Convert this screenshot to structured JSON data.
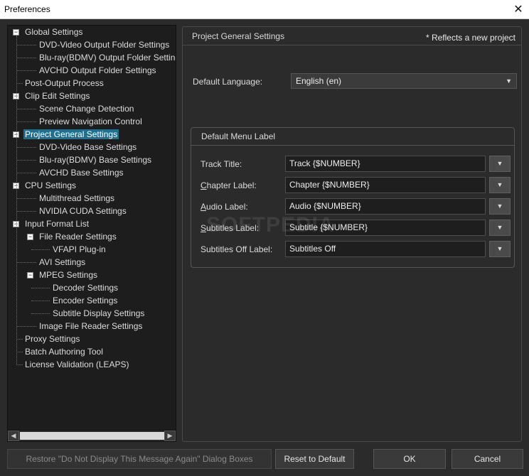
{
  "window": {
    "title": "Preferences"
  },
  "tree": [
    {
      "label": "Global Settings",
      "level": 0,
      "expander": "minus"
    },
    {
      "label": "DVD-Video Output Folder Settings",
      "level": 1
    },
    {
      "label": "Blu-ray(BDMV) Output Folder Settings",
      "level": 1
    },
    {
      "label": "AVCHD Output Folder Settings",
      "level": 1
    },
    {
      "label": "Post-Output Process",
      "level": 0
    },
    {
      "label": "Clip Edit Settings",
      "level": 0,
      "expander": "minus"
    },
    {
      "label": "Scene Change Detection",
      "level": 1
    },
    {
      "label": "Preview Navigation Control",
      "level": 1
    },
    {
      "label": "Project General Settings",
      "level": 0,
      "expander": "minus",
      "selected": true
    },
    {
      "label": "DVD-Video Base Settings",
      "level": 1
    },
    {
      "label": "Blu-ray(BDMV) Base Settings",
      "level": 1
    },
    {
      "label": "AVCHD Base Settings",
      "level": 1
    },
    {
      "label": "CPU Settings",
      "level": 0,
      "expander": "minus"
    },
    {
      "label": "Multithread Settings",
      "level": 1
    },
    {
      "label": "NVIDIA CUDA Settings",
      "level": 1
    },
    {
      "label": "Input Format List",
      "level": 0,
      "expander": "minus"
    },
    {
      "label": "File Reader Settings",
      "level": 1,
      "expander": "minus"
    },
    {
      "label": "VFAPI Plug-in",
      "level": 2
    },
    {
      "label": "AVI Settings",
      "level": 1
    },
    {
      "label": "MPEG Settings",
      "level": 1,
      "expander": "minus"
    },
    {
      "label": "Decoder Settings",
      "level": 2
    },
    {
      "label": "Encoder Settings",
      "level": 2
    },
    {
      "label": "Subtitle Display Settings",
      "level": 2
    },
    {
      "label": "Image File Reader Settings",
      "level": 1
    },
    {
      "label": "Proxy Settings",
      "level": 0
    },
    {
      "label": "Batch Authoring Tool",
      "level": 0
    },
    {
      "label": "License Validation (LEAPS)",
      "level": 0
    }
  ],
  "panel": {
    "title": "Project General Settings",
    "note": "* Reflects a new project",
    "language_label": "Default Language:",
    "language_value": "English (en)"
  },
  "menu_label": {
    "title": "Default Menu Label",
    "rows": [
      {
        "label": "Track Title:",
        "value": "Track {$NUMBER}"
      },
      {
        "label_pre": "",
        "label_u": "C",
        "label_post": "hapter Label:",
        "value": "Chapter {$NUMBER}"
      },
      {
        "label_pre": "",
        "label_u": "A",
        "label_post": "udio Label:",
        "value": "Audio {$NUMBER}"
      },
      {
        "label_pre": "",
        "label_u": "S",
        "label_post": "ubtitles Label:",
        "value": "Subtitle {$NUMBER}"
      },
      {
        "label": "Subtitles Off Label:",
        "value": "Subtitles Off"
      }
    ]
  },
  "watermark": "SOFTPEDIA",
  "buttons": {
    "restore": "Restore \"Do Not Display This Message Again\" Dialog Boxes",
    "reset": "Reset to Default",
    "ok": "OK",
    "cancel": "Cancel"
  },
  "icons": {
    "close": "close-icon",
    "dropdown": "chevron-down-icon",
    "expander": "minus-box-icon",
    "scroll_left": "arrow-left-icon",
    "scroll_right": "arrow-right-icon"
  },
  "colors": {
    "background": "#2b2b2b",
    "tree_background": "#1d1d1d",
    "selection": "#1f6f8f"
  }
}
